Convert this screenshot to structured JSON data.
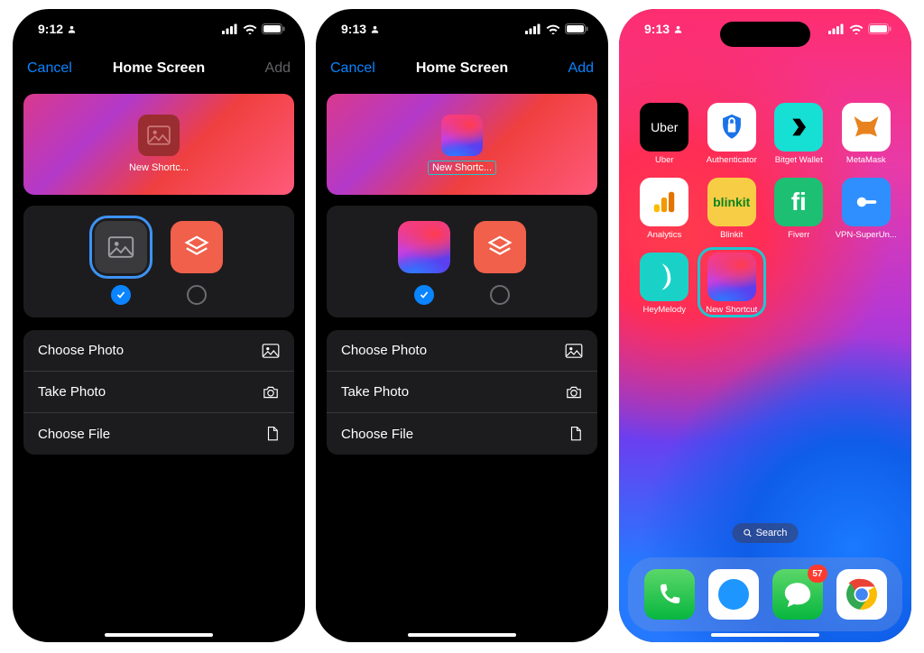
{
  "status": {
    "time1": "9:12",
    "time2": "9:13",
    "time3": "9:13"
  },
  "nav": {
    "cancel": "Cancel",
    "title": "Home Screen",
    "add": "Add"
  },
  "preview": {
    "label": "New Shortc..."
  },
  "options": {
    "choose_photo": "Choose Photo",
    "take_photo": "Take Photo",
    "choose_file": "Choose File"
  },
  "search_label": "Search",
  "home_apps": [
    {
      "name": "Uber"
    },
    {
      "name": "Authenticator"
    },
    {
      "name": "Bitget Wallet"
    },
    {
      "name": "MetaMask"
    },
    {
      "name": "Analytics"
    },
    {
      "name": "Blinkit"
    },
    {
      "name": "Fiverr"
    },
    {
      "name": "VPN-SuperUn..."
    },
    {
      "name": "HeyMelody"
    },
    {
      "name": "New Shortcut"
    }
  ],
  "dock": {
    "messages_badge": "57"
  }
}
